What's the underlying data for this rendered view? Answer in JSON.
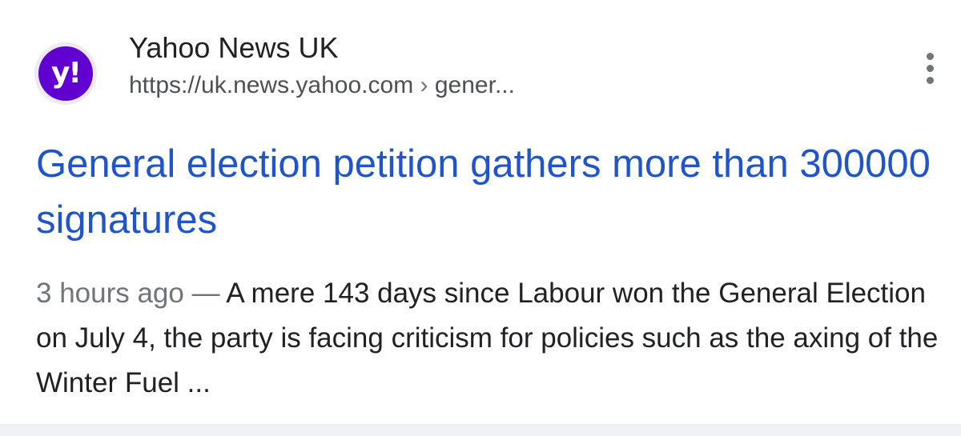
{
  "result": {
    "favicon": {
      "text": "y!",
      "icon": "yahoo-logo-icon",
      "color": "#6001d2"
    },
    "site_name": "Yahoo News UK",
    "url": {
      "domain": "https://uk.news.yahoo.com",
      "separator": "›",
      "path": "gener..."
    },
    "menu_icon": "more-vert-icon",
    "title": "General election petition gathers more than 300000 signatures",
    "snippet": {
      "date": "3 hours ago",
      "dash": " — ",
      "text": "A mere 143 days since Labour won the General Election on July 4, the party is facing criticism for policies such as the axing of the Winter Fuel ..."
    }
  },
  "colors": {
    "title_link": "#1f55cc",
    "body_text": "#202124",
    "secondary_text": "#70757a"
  }
}
